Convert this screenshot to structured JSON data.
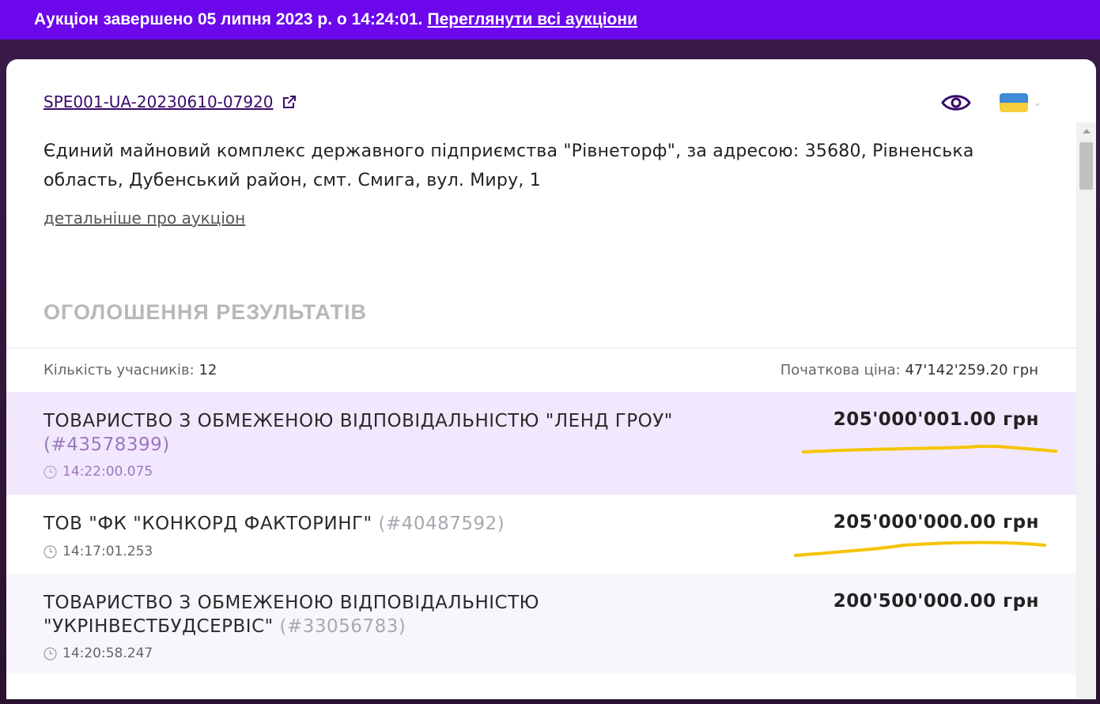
{
  "banner": {
    "text": "Аукціон завершено 05 липня 2023 р. о 14:24:01.",
    "link": "Переглянути всі аукціони"
  },
  "auction": {
    "id": "SPE001-UA-20230610-07920",
    "description": "Єдиний майновий комплекс державного підприємства \"Рівнеторф\", за адресою: 35680, Рівненська область, Дубенський район, смт. Смига, вул. Миру, 1",
    "more_link": "детальніше про аукціон"
  },
  "header_icons": {
    "eye": "eye-icon",
    "language_flag": "ukraine-flag-icon"
  },
  "colors": {
    "banner": "#6c08eb",
    "winner_row": "#f2e8fd",
    "highlight": "#f5c400"
  },
  "results": {
    "heading": "ОГОЛОШЕННЯ РЕЗУЛЬТАТІВ",
    "participants_label": "Кількість учасників:",
    "participants_value": "12",
    "start_price_label": "Початкова ціна:",
    "start_price_value": "47'142'259.20 грн",
    "bids": [
      {
        "name": "ТОВАРИСТВО З ОБМЕЖЕНОЮ ВІДПОВІДАЛЬНІСТЮ \"ЛЕНД ГРОУ\"",
        "code": "(#43578399)",
        "amount": "205'000'001.00 грн",
        "time": "14:22:00.075"
      },
      {
        "name": "ТОВ \"ФК \"КОНКОРД ФАКТОРИНГ\"",
        "code": "(#40487592)",
        "amount": "205'000'000.00 грн",
        "time": "14:17:01.253"
      },
      {
        "name": "ТОВАРИСТВО З ОБМЕЖЕНОЮ ВІДПОВІДАЛЬНІСТЮ \"УКРІНВЕСТБУДСЕРВІС\"",
        "code": "(#33056783)",
        "amount": "200'500'000.00 грн",
        "time": "14:20:58.247"
      }
    ]
  }
}
